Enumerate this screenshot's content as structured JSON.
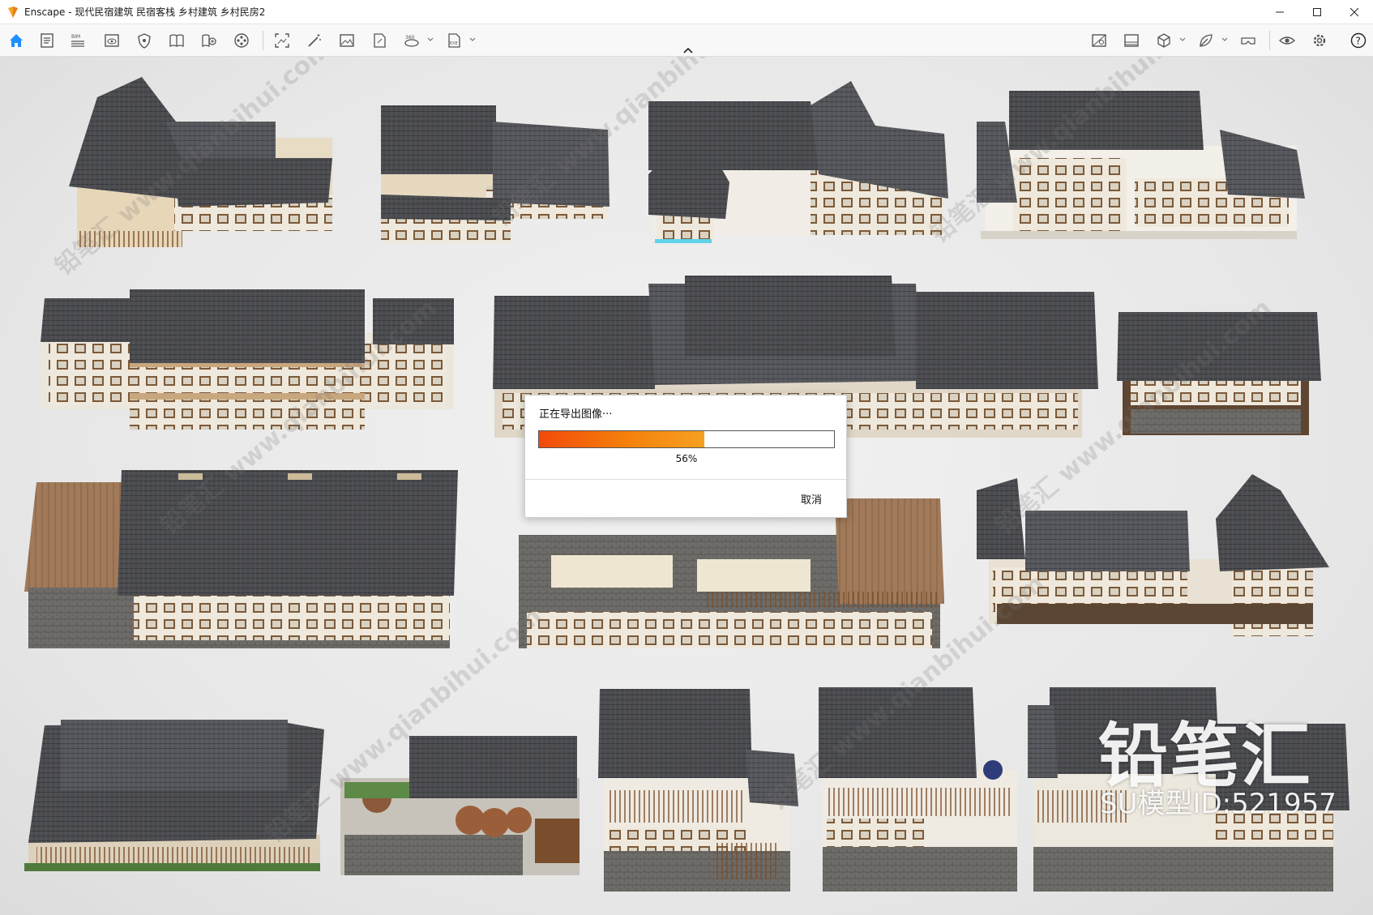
{
  "window": {
    "title": "Enscape - 现代民宿建筑 民宿客栈 乡村建筑 乡村民房2",
    "controls": [
      "minimize",
      "maximize",
      "close"
    ]
  },
  "toolbar": {
    "left_tools": [
      {
        "name": "home-icon",
        "active": true
      },
      {
        "name": "notes-icon"
      },
      {
        "name": "bim-icon",
        "label": "BIM"
      },
      {
        "name": "view-icon"
      },
      {
        "name": "shield-icon"
      },
      {
        "name": "book-icon"
      },
      {
        "name": "asset-icon"
      },
      {
        "name": "reel-icon"
      },
      {
        "name": "screenshot-icon"
      },
      {
        "name": "magic-wand-icon"
      },
      {
        "name": "image-icon"
      },
      {
        "name": "export-file-icon"
      },
      {
        "name": "panorama-360-icon",
        "label": "360"
      },
      {
        "name": "exe-export-icon",
        "label": "EXE"
      }
    ],
    "right_tools": [
      {
        "name": "visual-settings-icon"
      },
      {
        "name": "atmosphere-icon"
      },
      {
        "name": "cube-icon"
      },
      {
        "name": "leaf-icon"
      },
      {
        "name": "vr-headset-icon"
      },
      {
        "name": "eye-icon"
      },
      {
        "name": "settings-gear-icon"
      },
      {
        "name": "help-icon"
      }
    ]
  },
  "export_dialog": {
    "title": "正在导出图像···",
    "progress": 0.56,
    "progress_label": "56%",
    "cancel_label": "取消"
  },
  "watermark": {
    "brand": "铅笔汇",
    "model_id": "SU模型ID:521957",
    "tile_text": "铅笔汇 www.qianbihui.com"
  },
  "colors": {
    "accent": "#f5820c",
    "progress_start": "#f14a0a",
    "home_icon": "#1e90ff",
    "roof_tile": "#4a4b4f",
    "wall_white": "#f4f1ec",
    "timber": "#8a5a32"
  }
}
